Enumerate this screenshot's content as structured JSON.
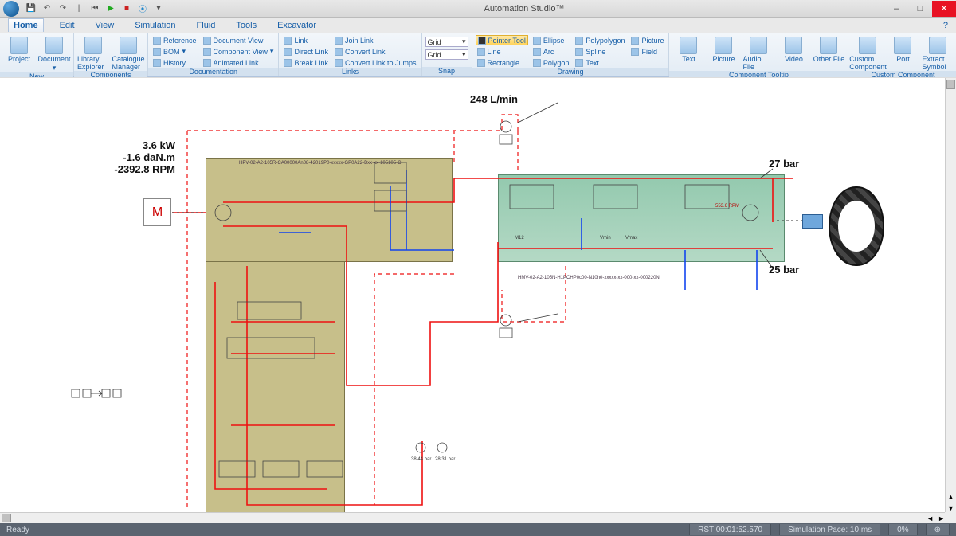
{
  "title": "Automation Studio™",
  "qat": {
    "undo": "↶",
    "redo": "↷",
    "play": "▶",
    "stop": "■",
    "step": "⦿"
  },
  "winbtns": {
    "min": "–",
    "max": "□",
    "close": "✕"
  },
  "tabs": [
    "Home",
    "Edit",
    "View",
    "Simulation",
    "Fluid",
    "Tools",
    "Excavator"
  ],
  "help": "?",
  "ribbon": {
    "new": {
      "label": "New",
      "project": "Project",
      "document": "Document"
    },
    "components": {
      "label": "Components",
      "library": "Library Explorer",
      "catalogue": "Catalogue Manager"
    },
    "documentation": {
      "label": "Documentation",
      "reference": "Reference",
      "docview": "Document View",
      "bom": "BOM",
      "compview": "Component View",
      "history": "History",
      "animlink": "Animated Link"
    },
    "links": {
      "label": "Links",
      "link": "Link",
      "joinlink": "Join Link",
      "directlink": "Direct Link",
      "convertlink": "Convert Link",
      "breaklink": "Break Link",
      "convertjumps": "Convert Link to Jumps"
    },
    "snap": {
      "label": "Snap",
      "grid": "Grid"
    },
    "drawing": {
      "label": "Drawing",
      "pointer": "Pointer Tool",
      "ellipse": "Ellipse",
      "polypolygon": "Polypolygon",
      "picture": "Picture",
      "line": "Line",
      "arc": "Arc",
      "spline": "Spline",
      "field": "Field",
      "rectangle": "Rectangle",
      "polygon": "Polygon",
      "text": "Text"
    },
    "tooltip": {
      "label": "Component Tooltip",
      "text": "Text",
      "picture": "Picture",
      "audio": "Audio File",
      "video": "Video",
      "other": "Other File"
    },
    "custom": {
      "label": "Custom Component",
      "custom": "Custom Component",
      "port": "Port",
      "extract": "Extract Symbol"
    }
  },
  "measurements": {
    "flow": "248 L/min",
    "power": "3.6 kW",
    "torque": "-1.6 daN.m",
    "speed": "-2392.8 RPM",
    "pressure_hi": "27 bar",
    "pressure_lo": "25 bar",
    "motor_rpm": "553.6 RPM",
    "bottom_p1": "38.44 bar",
    "bottom_p2": "28.31 bar",
    "vmin": "Vmin",
    "vmax": "Vmax",
    "m12": "M12"
  },
  "motor_label": "M",
  "parts": {
    "pump": "HPV-02-A2-105R-CA00000An08-42019P0-xxxxx-GP0A22-Bxx-xx-105105-C",
    "motor": "HMV-02-A2-105N-H1PCHP0c00-N10h0-xxxxx-xx-000-xx-000220N"
  },
  "status": {
    "ready": "Ready",
    "rst": "RST 00:01:52.570",
    "pace": "Simulation Pace: 10 ms",
    "zoom": "0%"
  },
  "scroll": {
    "left": "◄",
    "right": "►",
    "up": "▲",
    "down": "▼"
  }
}
